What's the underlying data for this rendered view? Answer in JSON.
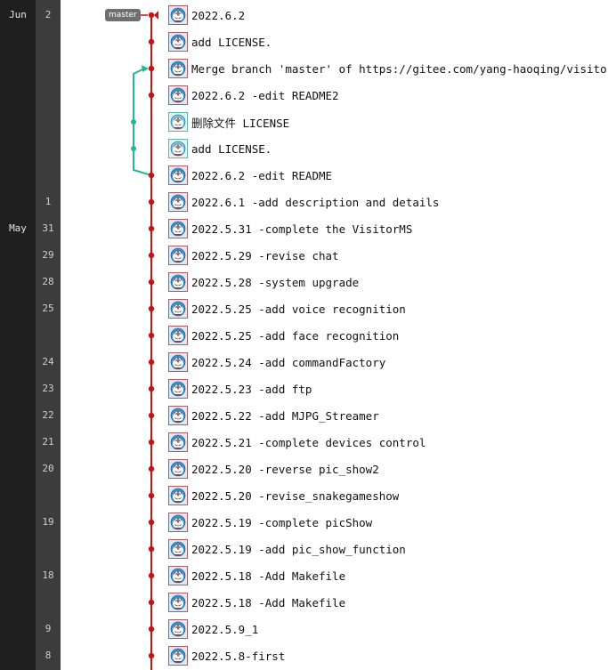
{
  "branch_tag": "master",
  "colors": {
    "main_line": "#cc1111",
    "merge_line": "#1fba8f"
  },
  "months": [
    {
      "label": "Jun",
      "row": 0
    },
    {
      "label": "May",
      "row": 8
    }
  ],
  "commits": [
    {
      "day": "2",
      "message": "2022.6.2",
      "avatar": "doraemon"
    },
    {
      "day": "",
      "message": "add LICENSE.",
      "avatar": "doraemon"
    },
    {
      "day": "",
      "message": "Merge branch 'master' of https://gitee.com/yang-haoqing/visitor-ms",
      "avatar": "doraemon"
    },
    {
      "day": "",
      "message": "2022.6.2 -edit README2",
      "avatar": "doraemon"
    },
    {
      "day": "",
      "message": "删除文件 LICENSE",
      "avatar": "doraemon-alt"
    },
    {
      "day": "",
      "message": "add LICENSE.",
      "avatar": "doraemon-alt"
    },
    {
      "day": "",
      "message": "2022.6.2 -edit README",
      "avatar": "doraemon"
    },
    {
      "day": "1",
      "message": "2022.6.1 -add description and details",
      "avatar": "doraemon"
    },
    {
      "day": "31",
      "message": "2022.5.31 -complete the VisitorMS",
      "avatar": "doraemon"
    },
    {
      "day": "29",
      "message": "2022.5.29 -revise chat",
      "avatar": "doraemon"
    },
    {
      "day": "28",
      "message": "2022.5.28 -system upgrade",
      "avatar": "doraemon"
    },
    {
      "day": "25",
      "message": "2022.5.25 -add voice recognition",
      "avatar": "doraemon"
    },
    {
      "day": "",
      "message": "2022.5.25 -add face recognition",
      "avatar": "doraemon"
    },
    {
      "day": "24",
      "message": "2022.5.24 -add commandFactory",
      "avatar": "doraemon"
    },
    {
      "day": "23",
      "message": "2022.5.23 -add ftp",
      "avatar": "doraemon"
    },
    {
      "day": "22",
      "message": "2022.5.22 -add MJPG_Streamer",
      "avatar": "doraemon"
    },
    {
      "day": "21",
      "message": "2022.5.21 -complete devices control",
      "avatar": "doraemon"
    },
    {
      "day": "20",
      "message": "2022.5.20 -reverse pic_show2",
      "avatar": "doraemon"
    },
    {
      "day": "",
      "message": "2022.5.20 -revise_snakegameshow",
      "avatar": "doraemon"
    },
    {
      "day": "19",
      "message": "2022.5.19 -complete picShow",
      "avatar": "doraemon"
    },
    {
      "day": "",
      "message": "2022.5.19 -add pic_show_function",
      "avatar": "doraemon"
    },
    {
      "day": "18",
      "message": "2022.5.18 -Add Makefile",
      "avatar": "doraemon"
    },
    {
      "day": "",
      "message": "2022.5.18 -Add Makefile",
      "avatar": "doraemon"
    },
    {
      "day": "9",
      "message": "2022.5.9_1",
      "avatar": "doraemon"
    },
    {
      "day": "8",
      "message": "2022.5.8-first",
      "avatar": "doraemon"
    }
  ]
}
